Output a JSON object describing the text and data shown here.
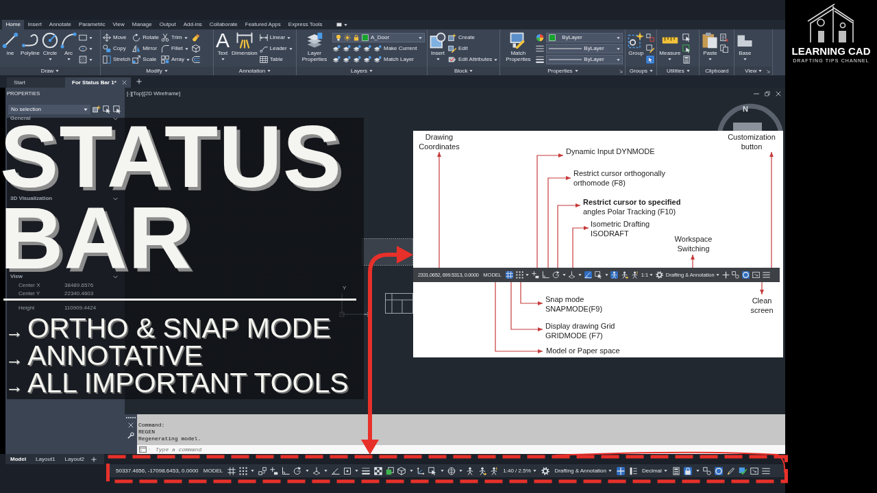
{
  "ribbon": {
    "tabs": [
      {
        "label": "Home",
        "selected": true
      },
      {
        "label": "Insert",
        "selected": false
      },
      {
        "label": "Annotate",
        "selected": false
      },
      {
        "label": "Parametric",
        "selected": false
      },
      {
        "label": "View",
        "selected": false
      },
      {
        "label": "Manage",
        "selected": false
      },
      {
        "label": "Output",
        "selected": false
      },
      {
        "label": "Add-ins",
        "selected": false
      },
      {
        "label": "Collaborate",
        "selected": false
      },
      {
        "label": "Featured Apps",
        "selected": false
      },
      {
        "label": "Express Tools",
        "selected": false
      }
    ],
    "panels": [
      {
        "title": "Draw",
        "menu": true,
        "columns": [
          {
            "kind": "large",
            "tools": [
              {
                "label": "ine",
                "kind": "line"
              },
              {
                "label": "Polyline",
                "kind": "polyline"
              },
              {
                "label": "Circle",
                "kind": "circle",
                "menu": true
              },
              {
                "label": "Arc",
                "kind": "arc",
                "menu": true
              }
            ]
          },
          {
            "kind": "stack",
            "tools": [
              {
                "kind": "rect",
                "menu": true
              },
              {
                "kind": "ellipse",
                "menu": true
              },
              {
                "kind": "hatch",
                "menu": true
              }
            ]
          }
        ]
      },
      {
        "title": "Modify",
        "menu": true,
        "columns": [
          {
            "kind": "stack",
            "tools": [
              {
                "label": "Move",
                "kind": "move"
              },
              {
                "label": "Copy",
                "kind": "copy"
              },
              {
                "label": "Stretch",
                "kind": "stretch"
              }
            ]
          },
          {
            "kind": "stack",
            "tools": [
              {
                "label": "Rotate",
                "kind": "rotate"
              },
              {
                "label": "Mirror",
                "kind": "mirror"
              },
              {
                "label": "Scale",
                "kind": "scale"
              }
            ]
          },
          {
            "kind": "stack",
            "tools": [
              {
                "label": "Trim",
                "kind": "trim",
                "menu": true
              },
              {
                "label": "Fillet",
                "kind": "fillet",
                "menu": true
              },
              {
                "label": "Array",
                "kind": "array",
                "menu": true
              }
            ]
          },
          {
            "kind": "stack",
            "tools": [
              {
                "kind": "erase"
              },
              {
                "kind": "explode"
              },
              {
                "kind": "offset"
              }
            ]
          }
        ]
      },
      {
        "title": "Annotation",
        "menu": true,
        "columns": [
          {
            "kind": "large",
            "tools": [
              {
                "label": "Text",
                "glyph": "A",
                "menu": true
              },
              {
                "label": "Dimension",
                "kind": "dimension"
              }
            ]
          },
          {
            "kind": "stack",
            "tools": [
              {
                "label": "Linear",
                "kind": "linear",
                "menu": true
              },
              {
                "label": "Leader",
                "kind": "leader",
                "menu": true
              },
              {
                "label": "Table",
                "kind": "table"
              }
            ]
          }
        ]
      },
      {
        "title": "Layers",
        "menu": true,
        "columns": [
          {
            "kind": "large",
            "tools": [
              {
                "label": "Layer Properties",
                "kind": "layers"
              }
            ]
          },
          {
            "kind": "rows",
            "rows": [
              {
                "kind": "layer_dropdown",
                "value": "A_Door"
              },
              {
                "kind": "tools",
                "tools": [
                  {
                    "kind": "laytool"
                  },
                  {
                    "kind": "laytool"
                  },
                  {
                    "kind": "laytool"
                  },
                  {
                    "kind": "laytool"
                  },
                  {
                    "kind": "laytool",
                    "label": "Make Current"
                  }
                ]
              },
              {
                "kind": "tools",
                "tools": [
                  {
                    "kind": "laytool"
                  },
                  {
                    "kind": "laytool"
                  },
                  {
                    "kind": "laytool"
                  },
                  {
                    "kind": "laytool"
                  },
                  {
                    "kind": "laytool",
                    "label": "Match Layer"
                  }
                ]
              }
            ]
          }
        ]
      },
      {
        "title": "Block",
        "menu": true,
        "columns": [
          {
            "kind": "large",
            "tools": [
              {
                "label": "Insert",
                "kind": "insert",
                "menu": true
              }
            ]
          },
          {
            "kind": "stack",
            "tools": [
              {
                "label": "Create",
                "kind": "create"
              },
              {
                "label": "Edit",
                "kind": "edit"
              },
              {
                "label": "Edit Attributes",
                "kind": "attedit",
                "menu": true
              }
            ]
          }
        ]
      },
      {
        "title": "Properties",
        "menu": true,
        "launcher": true,
        "columns": [
          {
            "kind": "large",
            "tools": [
              {
                "label": "Match Properties",
                "kind": "match"
              }
            ]
          },
          {
            "kind": "rows",
            "rows": [
              {
                "kind": "color_dropdown",
                "value": "ByLayer"
              },
              {
                "kind": "linetype_dropdown",
                "value": "ByLayer"
              },
              {
                "kind": "lineweight_dropdown",
                "value": "ByLayer"
              }
            ]
          }
        ]
      },
      {
        "title": "Groups",
        "menu": true,
        "columns": [
          {
            "kind": "large",
            "tools": [
              {
                "label": "Group",
                "kind": "group"
              }
            ]
          },
          {
            "kind": "stack",
            "tools": [
              {
                "kind": "ungroup",
                "on": false
              },
              {
                "kind": "groupedit",
                "on": false
              },
              {
                "kind": "groupsel",
                "on": true
              }
            ]
          }
        ]
      },
      {
        "title": "Utilities",
        "menu": true,
        "columns": [
          {
            "kind": "large",
            "tools": [
              {
                "label": "Measure",
                "kind": "measure",
                "menu": true
              }
            ]
          },
          {
            "kind": "stack",
            "tools": [
              {
                "kind": "qselect"
              },
              {
                "kind": "selectall"
              },
              {
                "kind": "calc"
              }
            ]
          }
        ]
      },
      {
        "title": "Clipboard",
        "columns": [
          {
            "kind": "large",
            "tools": [
              {
                "label": "Paste",
                "kind": "paste",
                "menu": true
              }
            ]
          },
          {
            "kind": "stack",
            "tools": [
              {
                "kind": "cutclip"
              },
              {
                "kind": "copyclip"
              }
            ]
          }
        ]
      },
      {
        "title": "View",
        "menu": true,
        "launcher": true,
        "columns": [
          {
            "kind": "large",
            "tools": [
              {
                "label": "Base",
                "kind": "base",
                "menu": true
              }
            ]
          }
        ]
      }
    ]
  },
  "file_tabs": [
    {
      "label": "Start",
      "selected": false
    },
    {
      "label": "For Status Bar 1*",
      "selected": true
    }
  ],
  "properties_panel": {
    "title": "PROPERTIES",
    "selection": "No selection",
    "sections": [
      {
        "title": "General",
        "expanded": true
      },
      {
        "title": "3D Visualization",
        "expanded": true
      },
      {
        "title": "View",
        "expanded": true,
        "rows": [
          {
            "label": "Center X",
            "value": "38489.6576"
          },
          {
            "label": "Center Y",
            "value": "22340.4603"
          },
          {
            "label": "Height",
            "value": "110909.4424"
          }
        ]
      }
    ]
  },
  "viewport": {
    "label": "[-][Top][2D Wireframe]",
    "compass": "N",
    "ucs_label": "Y"
  },
  "overlay": {
    "headline": [
      "STATUS",
      "BAR"
    ],
    "bullets": [
      {
        "marker": "→",
        "text": "ORTHO & SNAP MODE"
      },
      {
        "marker": "→",
        "text": "ANNOTATIVE"
      },
      {
        "marker": "→",
        "text": "ALL IMPORTANT TOOLS"
      }
    ]
  },
  "diagram": {
    "callouts": [
      {
        "lines": [
          "Drawing",
          "Coordinates"
        ]
      },
      {
        "lines": [
          "Customization",
          "button"
        ]
      },
      {
        "lines": [
          "Dynamic Input DYNMODE"
        ]
      },
      {
        "lines": [
          "Restrict cursor orthogonally",
          "orthomode (F8)"
        ]
      },
      {
        "lines": [
          "**Restrict cursor to specified**",
          "angles Polar Tracking (F10)"
        ]
      },
      {
        "lines": [
          "Isometric Drafting",
          "ISODRAFT"
        ]
      },
      {
        "lines": [
          "Workspace",
          "Switching"
        ]
      },
      {
        "lines": [
          "Snap mode",
          "SNAPMODE(F9)"
        ]
      },
      {
        "lines": [
          "Clean",
          "screen"
        ]
      },
      {
        "lines": [
          "Display drawing Grid",
          "GRIDMODE (F7)"
        ]
      },
      {
        "lines": [
          "Model or Paper space"
        ]
      }
    ],
    "status_bar": {
      "items": [
        {
          "kind": "coords",
          "text": "2331.0652, 699.5313, 0.0000"
        },
        {
          "kind": "label",
          "text": "MODEL"
        },
        {
          "kind": "grid",
          "on": true
        },
        {
          "kind": "snap",
          "on": false
        },
        {
          "kind": "caret"
        },
        {
          "kind": "dyninput",
          "on": false
        },
        {
          "kind": "ortho",
          "on": false
        },
        {
          "kind": "polar",
          "on": false
        },
        {
          "kind": "caret"
        },
        {
          "kind": "isodraft",
          "on": false
        },
        {
          "kind": "caret"
        },
        {
          "kind": "tracking",
          "on": true
        },
        {
          "kind": "filter",
          "on": false
        },
        {
          "kind": "caret"
        },
        {
          "kind": "annovis",
          "on": true
        },
        {
          "kind": "autoscale",
          "on": false
        },
        {
          "kind": "annoscale",
          "on": false
        },
        {
          "kind": "dropdown",
          "text": "1:1"
        },
        {
          "kind": "gear"
        },
        {
          "kind": "dropdown",
          "text": "Drafting & Annotation"
        },
        {
          "kind": "plus",
          "on": false
        },
        {
          "kind": "isolateobj",
          "on": false
        },
        {
          "kind": "hardware",
          "on": true
        },
        {
          "kind": "fullscreen"
        },
        {
          "kind": "menu"
        }
      ]
    }
  },
  "command_line": {
    "history": [
      "Command:",
      "REGEN",
      "Regenerating model."
    ],
    "placeholder": "Type a command"
  },
  "layout_tabs": [
    {
      "label": "Model",
      "selected": true
    },
    {
      "label": "Layout1",
      "selected": false
    },
    {
      "label": "Layout2",
      "selected": false
    }
  ],
  "status_bar": {
    "items": [
      {
        "kind": "coords",
        "text": "50337.4656, -17098.6453, 0.0000"
      },
      {
        "kind": "label",
        "text": "MODEL"
      },
      {
        "kind": "grid",
        "on": false
      },
      {
        "kind": "snap",
        "on": false
      },
      {
        "kind": "caret"
      },
      {
        "kind": "infer",
        "on": false
      },
      {
        "kind": "dyninput",
        "on": false
      },
      {
        "kind": "ortho",
        "on": false
      },
      {
        "kind": "polar",
        "on": false
      },
      {
        "kind": "caret"
      },
      {
        "kind": "isodraft",
        "on": false
      },
      {
        "kind": "caret"
      },
      {
        "kind": "tracking",
        "on": false
      },
      {
        "kind": "osnap",
        "on": false
      },
      {
        "kind": "caret"
      },
      {
        "kind": "lineweight",
        "on": false
      },
      {
        "kind": "transparency",
        "on": false
      },
      {
        "kind": "cycling",
        "on": false
      },
      {
        "kind": "osnap3d",
        "on": false
      },
      {
        "kind": "caret"
      },
      {
        "kind": "ucs",
        "on": false
      },
      {
        "kind": "filter",
        "on": false
      },
      {
        "kind": "caret"
      },
      {
        "kind": "gizmo",
        "on": false
      },
      {
        "kind": "caret"
      },
      {
        "kind": "annovis",
        "on": false
      },
      {
        "kind": "autoscale",
        "on": false
      },
      {
        "kind": "annoscale",
        "on": false
      },
      {
        "kind": "dropdown",
        "text": "1:40 / 2.5%"
      },
      {
        "kind": "gear"
      },
      {
        "kind": "dropdown",
        "text": "Drafting & Annotation"
      },
      {
        "kind": "plus",
        "on": true
      },
      {
        "kind": "isolate",
        "on": false
      },
      {
        "kind": "dropdown",
        "text": "Decimal"
      },
      {
        "kind": "calc"
      },
      {
        "kind": "lock",
        "on": true
      },
      {
        "kind": "caret"
      },
      {
        "kind": "isolateobj",
        "on": false
      },
      {
        "kind": "hardware",
        "on": true
      },
      {
        "kind": "pen",
        "on": false
      },
      {
        "kind": "check",
        "on": false
      },
      {
        "kind": "fullscreen"
      },
      {
        "kind": "menu"
      }
    ]
  },
  "brand": {
    "name": "LEARNING CAD",
    "tagline": "DRAFTING TIPS CHANNEL"
  }
}
